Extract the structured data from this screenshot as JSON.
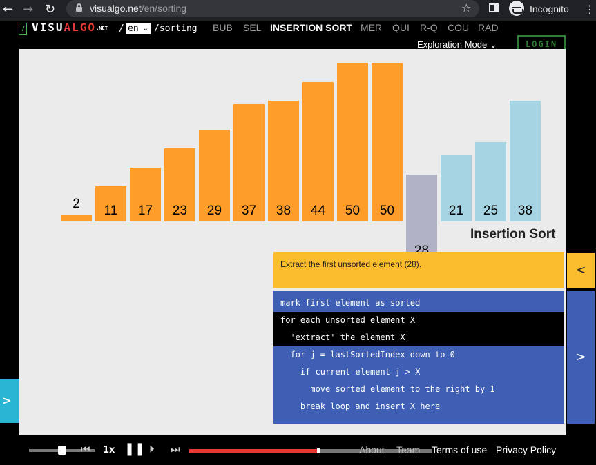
{
  "browser": {
    "url_host": "visualgo.net",
    "url_path": "/en/sorting",
    "profile_label": "Incognito",
    "icons": [
      "back-arrow-icon",
      "forward-arrow-icon",
      "reload-icon",
      "lock-icon",
      "star-icon",
      "side-panel-icon",
      "incognito-icon",
      "kebab-menu-icon"
    ]
  },
  "header": {
    "badge": "7",
    "logo_visu": "VISU",
    "logo_algo": "ALGO",
    "logo_net": ".NET",
    "slash": "/",
    "lang": "en",
    "lang_chevron": "⌄",
    "path": "/sorting",
    "nav": [
      "BUB",
      "SEL",
      "INSERTION SORT",
      "MER",
      "QUI",
      "R-Q",
      "COU",
      "RAD"
    ],
    "active": "INSERTION SORT",
    "exploration_mode": "Exploration Mode ⌄",
    "login": "LOGIN"
  },
  "viz": {
    "title": "Insertion Sort",
    "array": [
      {
        "value": 2,
        "state": "sorted"
      },
      {
        "value": 11,
        "state": "sorted"
      },
      {
        "value": 17,
        "state": "sorted"
      },
      {
        "value": 23,
        "state": "sorted"
      },
      {
        "value": 29,
        "state": "sorted"
      },
      {
        "value": 37,
        "state": "sorted"
      },
      {
        "value": 38,
        "state": "sorted"
      },
      {
        "value": 44,
        "state": "sorted"
      },
      {
        "value": 50,
        "state": "sorted"
      },
      {
        "value": 50,
        "state": "sorted"
      },
      {
        "value": 28,
        "state": "extracted"
      },
      {
        "value": 21,
        "state": "unsorted"
      },
      {
        "value": 25,
        "state": "unsorted"
      },
      {
        "value": 38,
        "state": "unsorted"
      }
    ],
    "colors": {
      "sorted": "#ff9d2a",
      "extracted": "#b0b3c6",
      "unsorted": "#a6d4e3"
    }
  },
  "status": "Extract the first unsorted element (28).",
  "pseudocode": {
    "lines": [
      "mark first element as sorted",
      "for each unsorted element X",
      "  'extract' the element X",
      "  for j = lastSortedIndex down to 0",
      "    if current element j > X",
      "      move sorted element to the right by 1",
      "    break loop and insert X here"
    ],
    "highlighted": [
      1,
      2
    ]
  },
  "side_tabs": {
    "collapse_status": "<",
    "expand_code": ">",
    "left_panel": ">"
  },
  "controls": {
    "speed_label": "1x",
    "speed_fraction": 0.5,
    "progress_fraction": 0.53,
    "buttons": [
      "go-to-beginning",
      "step-backward",
      "pause",
      "step-forward",
      "go-to-end"
    ]
  },
  "footer": {
    "about": "About",
    "team": "Team",
    "terms": "Terms of use",
    "privacy": "Privacy Policy"
  }
}
